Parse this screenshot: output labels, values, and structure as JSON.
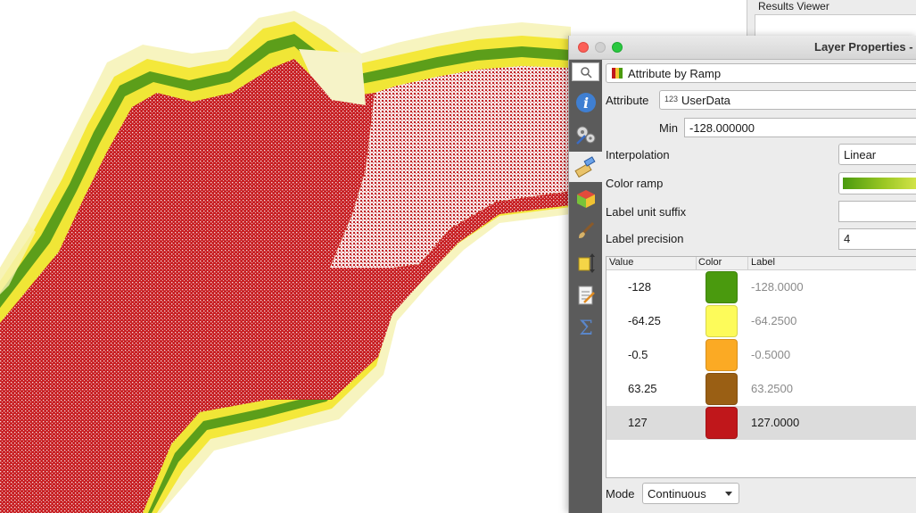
{
  "results_viewer": {
    "title": "Results Viewer"
  },
  "dialog": {
    "title": "Layer Properties -",
    "renderer": "Attribute by Ramp",
    "attribute": {
      "label": "Attribute",
      "type_badge": "123",
      "value": "UserData"
    },
    "min": {
      "label": "Min",
      "value": "-128.000000"
    },
    "interpolation": {
      "label": "Interpolation",
      "value": "Linear"
    },
    "color_ramp": {
      "label": "Color ramp"
    },
    "label_unit_suffix": {
      "label": "Label unit suffix",
      "value": ""
    },
    "label_precision": {
      "label": "Label precision",
      "value": "4"
    },
    "table": {
      "headers": {
        "value": "Value",
        "color": "Color",
        "label": "Label"
      },
      "rows": [
        {
          "value": "-128",
          "color": "#4a9a0e",
          "label": "-128.0000"
        },
        {
          "value": "-64.25",
          "color": "#fdfb5a",
          "label": "-64.2500"
        },
        {
          "value": "-0.5",
          "color": "#fbaa24",
          "label": "-0.5000"
        },
        {
          "value": "63.25",
          "color": "#9a5f14",
          "label": "63.2500"
        },
        {
          "value": "127",
          "color": "#c0171b",
          "label": "127.0000"
        }
      ]
    },
    "mode": {
      "label": "Mode",
      "value": "Continuous"
    }
  },
  "sidebar_icons": [
    "search-icon",
    "information-icon",
    "source-settings-icon",
    "symbology-icon",
    "3d-view-icon",
    "rendering-brush-icon",
    "elevation-icon",
    "metadata-icon",
    "statistics-sigma-icon"
  ]
}
